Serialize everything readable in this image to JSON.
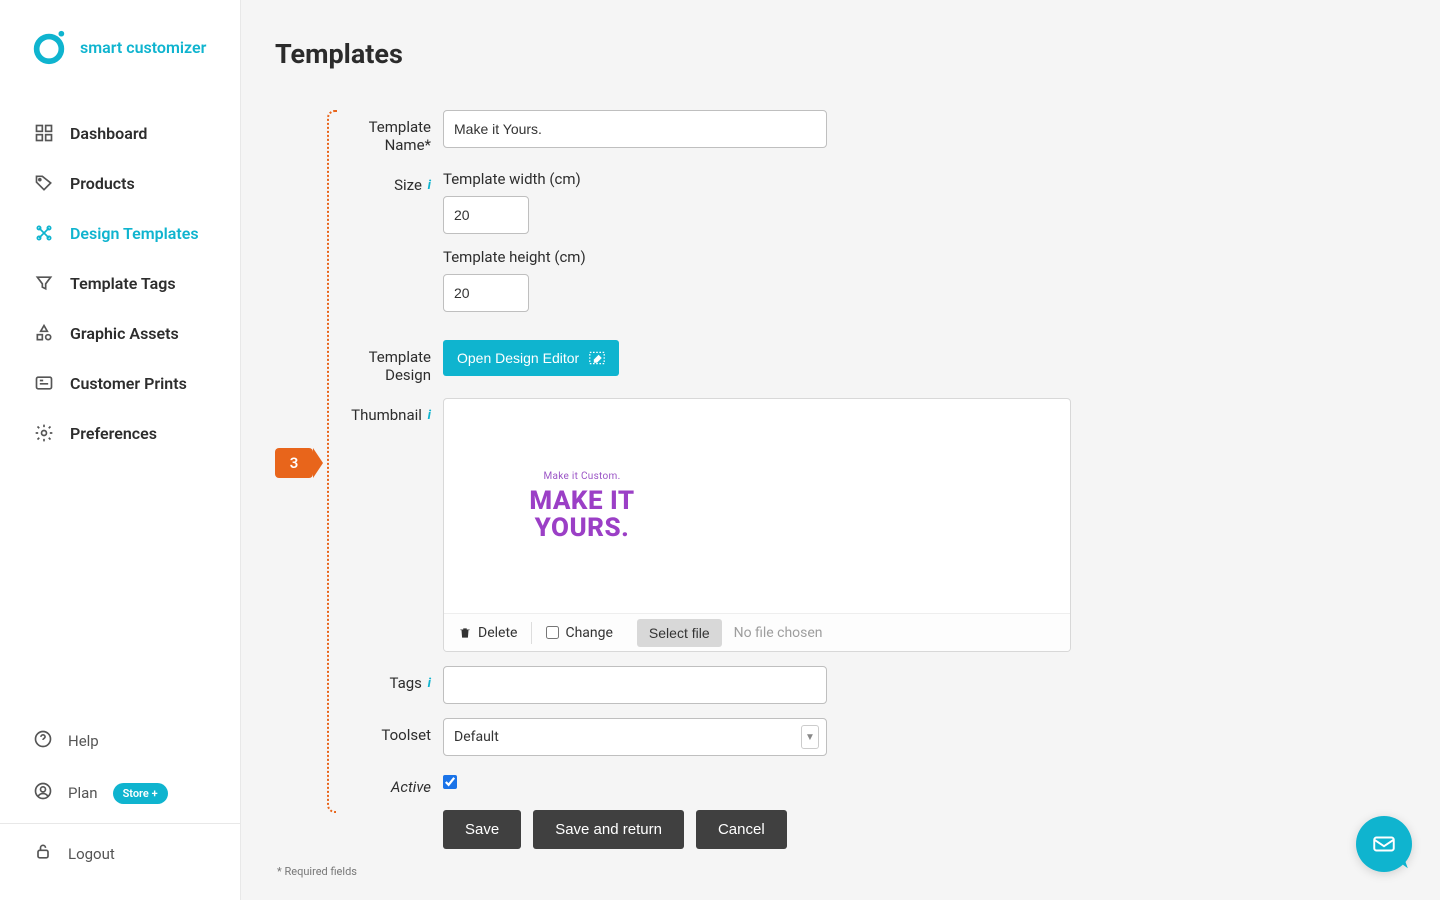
{
  "brand": {
    "name": "smart customizer"
  },
  "sidebar": {
    "items": [
      {
        "label": "Dashboard"
      },
      {
        "label": "Products"
      },
      {
        "label": "Design Templates"
      },
      {
        "label": "Template Tags"
      },
      {
        "label": "Graphic Assets"
      },
      {
        "label": "Customer Prints"
      },
      {
        "label": "Preferences"
      }
    ],
    "footer": {
      "help": "Help",
      "plan": "Plan",
      "plan_badge": "Store +",
      "logout": "Logout"
    }
  },
  "page": {
    "title": "Templates",
    "step_number": "3",
    "required_note": "* Required fields"
  },
  "form": {
    "template_name_label": "Template Name*",
    "template_name_value": "Make it Yours.",
    "size_label": "Size",
    "width_label": "Template width (cm)",
    "width_value": "20",
    "height_label": "Template height (cm)",
    "height_value": "20",
    "template_design_label": "Template Design",
    "open_editor_label": "Open Design Editor",
    "thumbnail_label": "Thumbnail",
    "thumbnail_small_text": "Make it Custom.",
    "thumbnail_big_line1": "MAKE IT",
    "thumbnail_big_line2": "YOURS.",
    "thumb_delete": "Delete",
    "thumb_change": "Change",
    "thumb_select_file": "Select file",
    "thumb_no_file": "No file chosen",
    "tags_label": "Tags",
    "tags_value": "",
    "toolset_label": "Toolset",
    "toolset_value": "Default",
    "active_label": "Active",
    "active_checked": true,
    "save": "Save",
    "save_return": "Save and return",
    "cancel": "Cancel"
  }
}
